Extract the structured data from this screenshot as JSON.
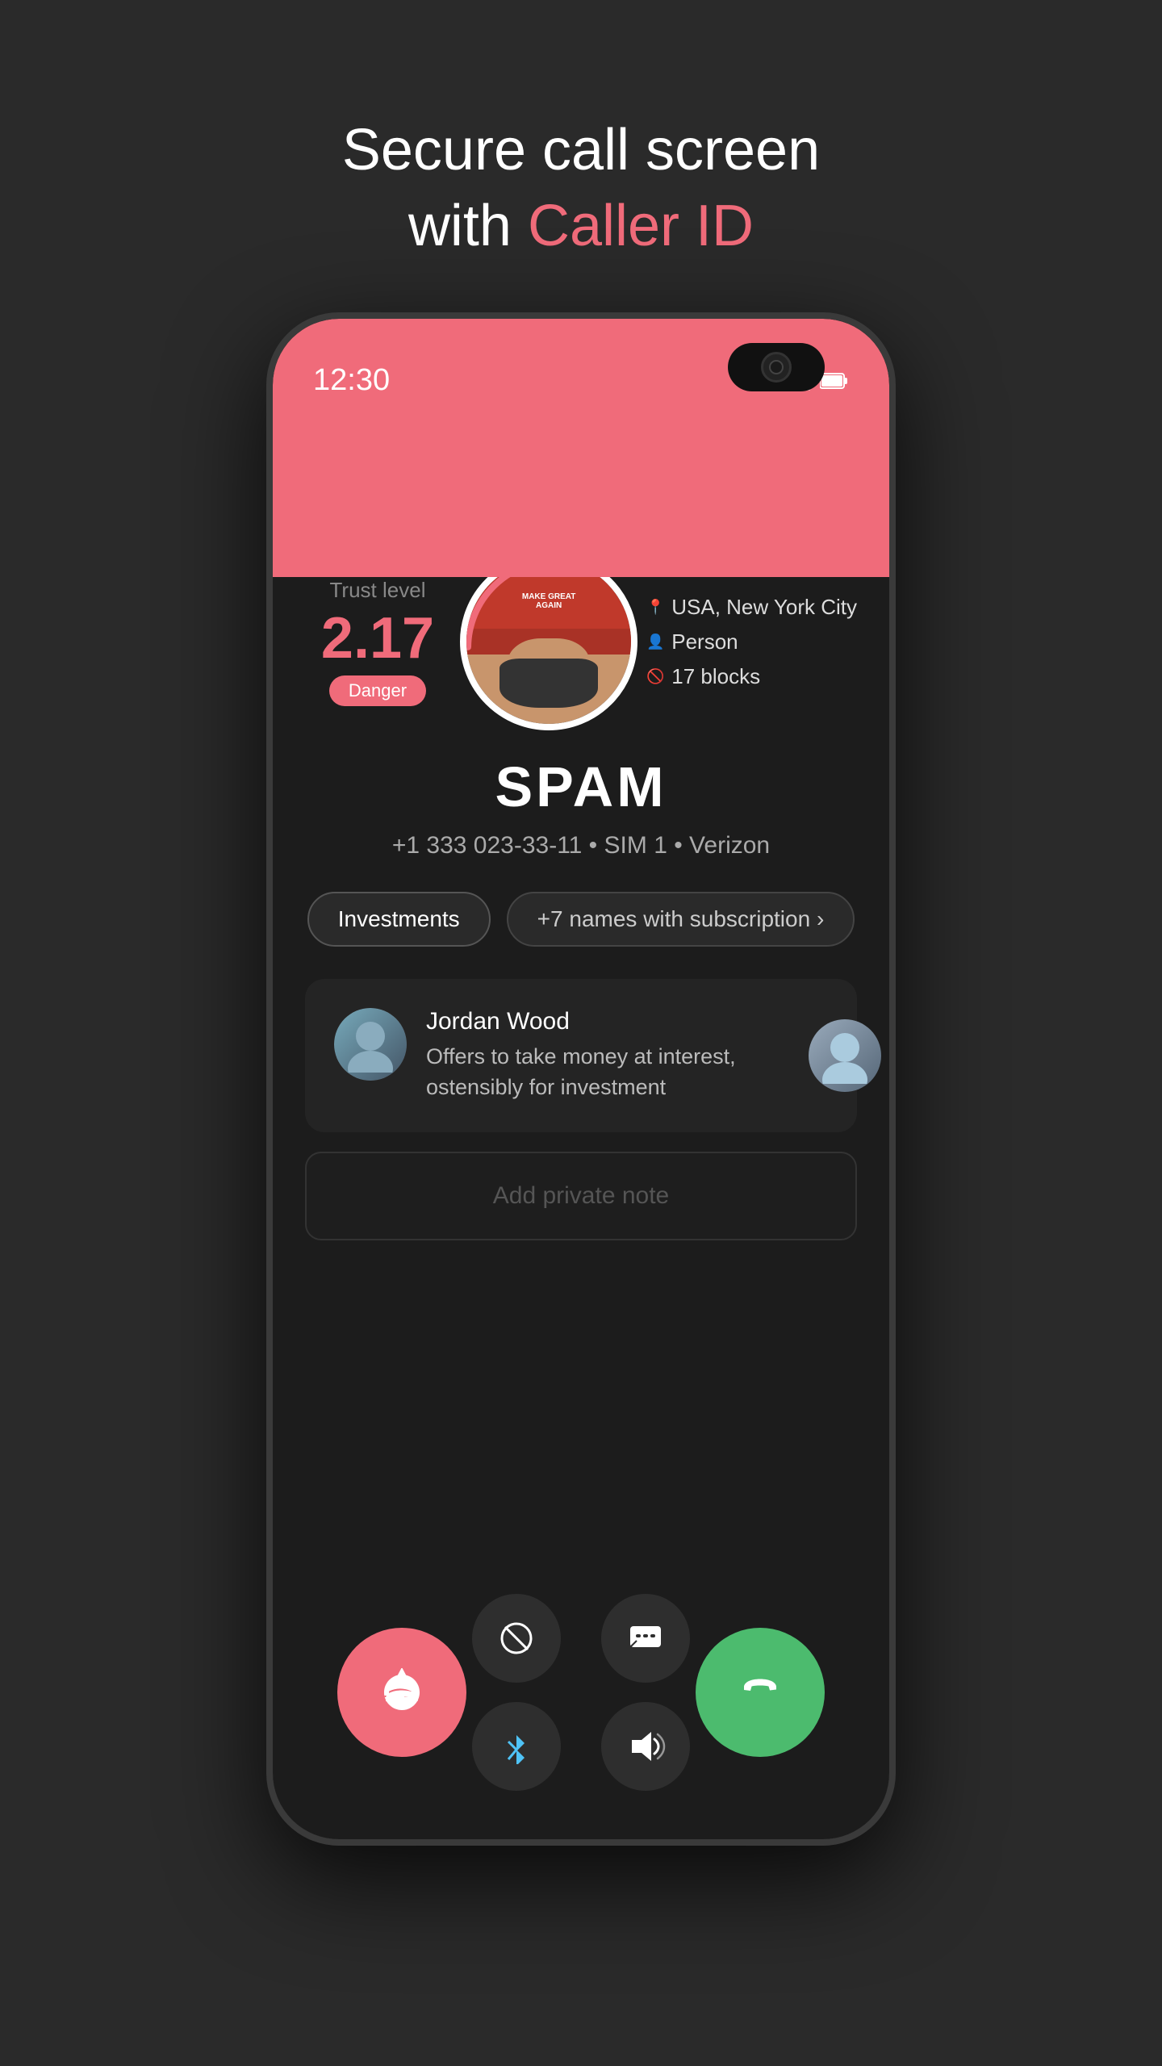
{
  "page": {
    "background_color": "#2a2a2a",
    "title_line1": "Secure call screen",
    "title_line2_prefix": "with ",
    "title_line2_accent": "Caller ID"
  },
  "status_bar": {
    "time": "12:30",
    "wifi": "▼",
    "signal": "◀",
    "battery": "🔋"
  },
  "caller": {
    "trust_label": "Trust level",
    "trust_number": "2.17",
    "danger_badge": "Danger",
    "name": "SPAM",
    "phone": "+1 333 023-33-11 • SIM 1 • Verizon",
    "location": "USA, New York City",
    "category": "Person",
    "blocks": "17 blocks"
  },
  "tags": {
    "tag1": "Investments",
    "tag2": "+7 names with subscription ›"
  },
  "comment": {
    "author": "Jordan Wood",
    "text": "Offers to take money at interest, ostensibly for investment"
  },
  "note": {
    "placeholder": "Add private note"
  },
  "actions": {
    "block_label": "⊘",
    "message_label": "💬",
    "bluetooth_label": "Bluetooth",
    "speaker_label": "Speaker",
    "decline_label": "✆",
    "accept_label": "✆"
  }
}
